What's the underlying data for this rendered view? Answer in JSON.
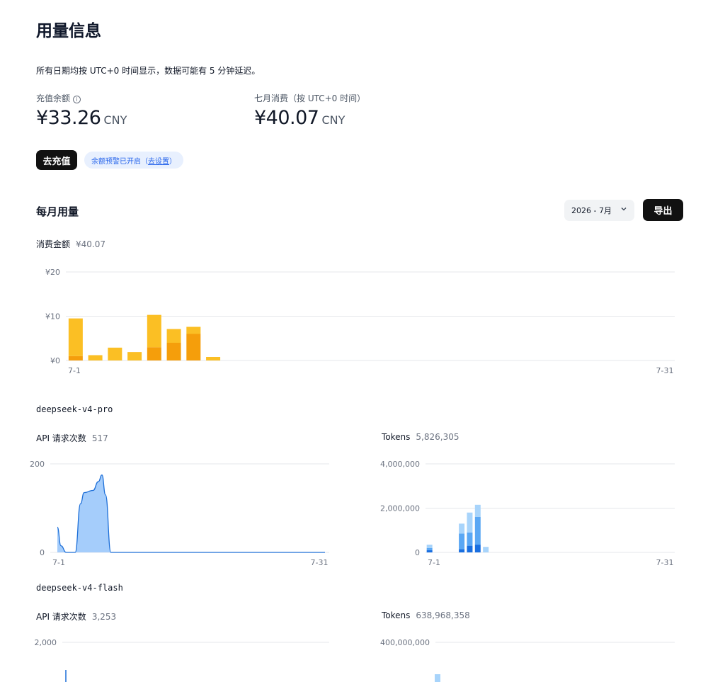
{
  "page": {
    "title": "用量信息",
    "subtitle": "所有日期均按 UTC+0 时间显示，数据可能有 5 分钟延迟。"
  },
  "balance": {
    "label": "充值余额",
    "value": "¥33.26",
    "unit": "CNY",
    "info_icon": "info-circle-icon"
  },
  "month_spend": {
    "label": "七月消费（按 UTC+0 时间）",
    "value": "¥40.07",
    "unit": "CNY"
  },
  "actions": {
    "recharge_label": "去充值",
    "alert_text": "余额预警已开启",
    "alert_link_open": "（",
    "alert_link": "去设置",
    "alert_link_close": "）"
  },
  "monthly": {
    "title": "每月用量",
    "month_value": "2026 - 7月",
    "export_label": "导出",
    "cost_label": "消费金额",
    "cost_value": "¥40.07"
  },
  "colors": {
    "cost_light": "#fbbf24",
    "cost_dark": "#f59e0b",
    "area_fill": "#a5cdfb",
    "area_stroke": "#1d6fd8",
    "tok_light": "#a8d4fb",
    "tok_mid": "#5aa7f4",
    "tok_dark": "#1a6fe0",
    "grid": "#e5e7eb"
  },
  "models": [
    {
      "name": "deepseek-v4-pro",
      "requests_label": "API 请求次数",
      "requests_value": "517",
      "tokens_label": "Tokens",
      "tokens_value": "5,826,305"
    },
    {
      "name": "deepseek-v4-flash",
      "requests_label": "API 请求次数",
      "requests_value": "3,253",
      "tokens_label": "Tokens",
      "tokens_value": "638,968,358"
    }
  ],
  "chart_data": [
    {
      "type": "bar",
      "stacked": true,
      "ylim": [
        0,
        20
      ],
      "yticks": [
        "¥20",
        "¥10",
        "¥0"
      ],
      "ytick_values": [
        20,
        10,
        0
      ],
      "xlabels": [
        "7-1",
        "7-31"
      ],
      "days": 31,
      "series": [
        {
          "values": [
            1.0,
            0.0,
            0.0,
            0.0,
            3.0,
            4.0,
            6.0,
            0.0
          ]
        },
        {
          "values": [
            8.5,
            1.2,
            2.9,
            1.9,
            7.3,
            3.1,
            1.6,
            0.8
          ]
        }
      ]
    },
    {
      "type": "area",
      "ylim": [
        0,
        200
      ],
      "yticks": [
        "200",
        "0"
      ],
      "ytick_values": [
        200,
        0
      ],
      "xlabels": [
        "7-1",
        "7-31"
      ],
      "x": [
        1,
        1.4,
        2,
        3,
        3.6,
        4,
        5,
        5.6,
        6,
        6.4,
        7,
        8,
        31
      ],
      "values": [
        57,
        15,
        0,
        0,
        110,
        135,
        140,
        160,
        175,
        130,
        0,
        0,
        0
      ]
    },
    {
      "type": "bar",
      "stacked": true,
      "ylim": [
        0,
        4000000
      ],
      "yticks": [
        "4,000,000",
        "2,000,000",
        "0"
      ],
      "ytick_values": [
        4000000,
        2000000,
        0
      ],
      "xlabels": [
        "7-1",
        "7-31"
      ],
      "days": 31,
      "bar_days": [
        1,
        5,
        6,
        7,
        8
      ],
      "series": [
        {
          "values": [
            100000,
            150000,
            300000,
            350000,
            0
          ]
        },
        {
          "values": [
            100000,
            700000,
            600000,
            1250000,
            0
          ]
        },
        {
          "values": [
            150000,
            450000,
            900000,
            550000,
            250000
          ]
        }
      ]
    },
    {
      "type": "area",
      "ylim": [
        0,
        2000
      ],
      "yticks": [
        "2,000"
      ],
      "ytick_values": [
        2000
      ],
      "xlabels": [],
      "partial": true
    },
    {
      "type": "bar",
      "stacked": true,
      "ylim": [
        0,
        400000000
      ],
      "yticks": [
        "400,000,000"
      ],
      "ytick_values": [
        400000000
      ],
      "xlabels": [],
      "partial": true
    }
  ]
}
